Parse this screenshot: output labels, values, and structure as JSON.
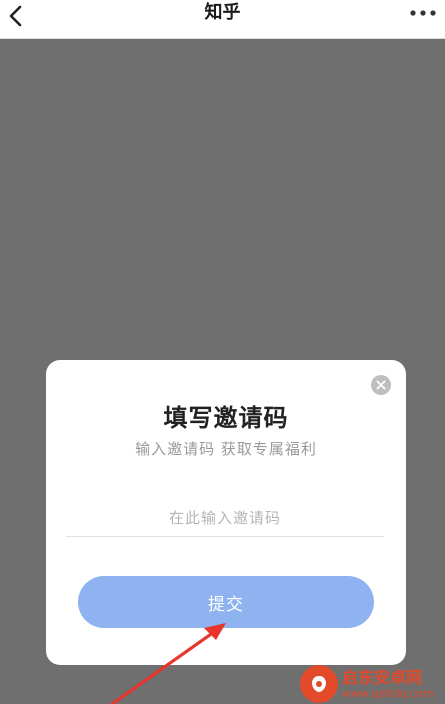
{
  "topbar": {
    "title": "知乎",
    "back_icon": "chevron-left-icon",
    "more_icon": "more-dots-icon"
  },
  "dialog": {
    "title": "填写邀请码",
    "subtitle": "输入邀请码 获取专属福利",
    "input_placeholder": "在此输入邀请码",
    "input_value": "",
    "submit_label": "提交",
    "close_icon": "close-icon"
  },
  "watermark": {
    "name": "启东安卓网",
    "url": "www.qdltdq.com"
  },
  "colors": {
    "overlay": "#6f6f6f",
    "submit_button": "#8fb3f0",
    "annotation_arrow": "#e8352c",
    "watermark": "#e24a2a"
  }
}
